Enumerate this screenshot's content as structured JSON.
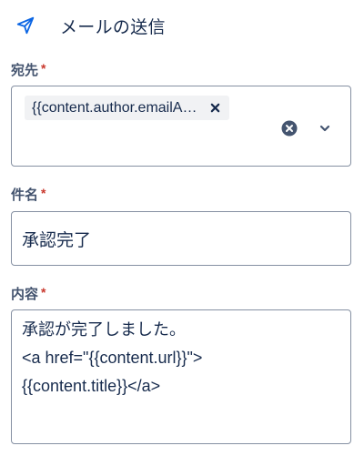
{
  "header": {
    "title": "メールの送信",
    "icon": "send-icon",
    "accent_color": "#0c66e4"
  },
  "fields": {
    "recipient": {
      "label": "宛先",
      "required_marker": "*",
      "chips": [
        "{{content.author.emailA…"
      ]
    },
    "subject": {
      "label": "件名",
      "required_marker": "*",
      "value": "承認完了"
    },
    "body": {
      "label": "内容",
      "required_marker": "*",
      "lines": [
        "承認が完了しました。",
        "<a href=\"{{content.url}}\">",
        "{{content.title}}</a>"
      ]
    }
  },
  "colors": {
    "required": "#c9372c",
    "border": "#8590a2",
    "label": "#44546f",
    "text": "#172b4d"
  }
}
